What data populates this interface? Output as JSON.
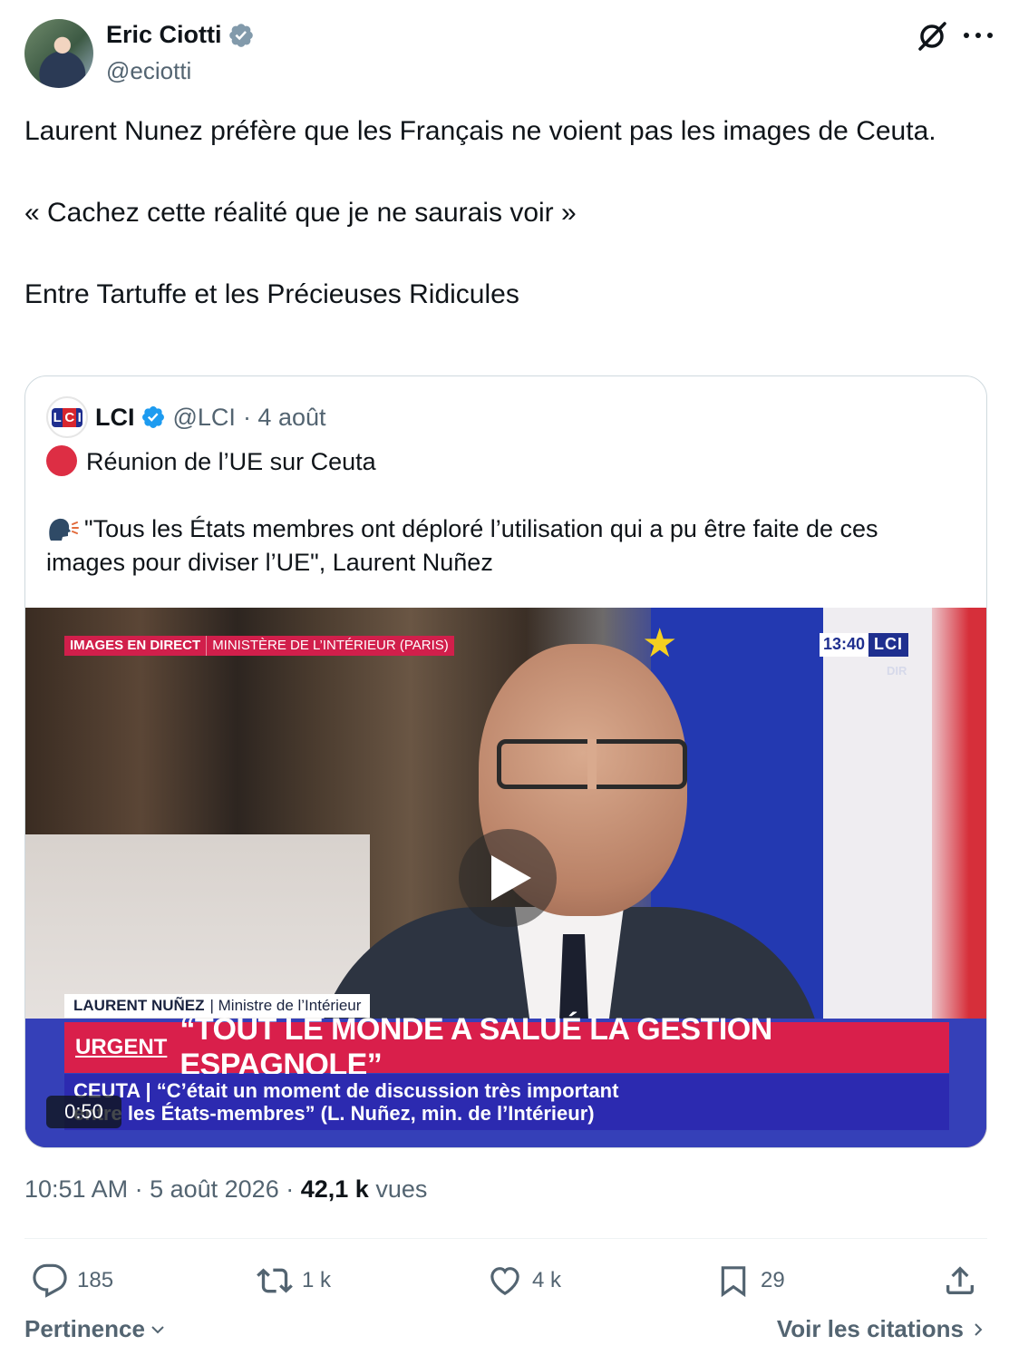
{
  "author": {
    "display_name": "Eric Ciotti",
    "handle": "@eciotti"
  },
  "tweet": {
    "lines": [
      "Laurent Nunez préfère que les Français ne voient pas les images de Ceuta.",
      "« Cachez cette réalité que je ne saurais voir »",
      "Entre Tartuffe et les Précieuses Ridicules"
    ]
  },
  "quote": {
    "avatar_letters": [
      "L",
      "C",
      "I"
    ],
    "name": "LCI",
    "handle": "@LCI",
    "date": "· 4 août",
    "line1": "Réunion de l’UE sur Ceuta",
    "line2": "\"Tous les États membres ont déploré l’utilisation qui a pu être faite de ces images pour diviser l’UE\", Laurent Nuñez",
    "video": {
      "banner_left": "IMAGES EN DIRECT",
      "banner_right": "MINISTÈRE DE L’INTÉRIEUR (PARIS)",
      "clock": "13:40",
      "channel_logo": "LCI",
      "channel_sub": "DIR",
      "person_name": "LAURENT NUÑEZ",
      "person_title": "| Ministre de l’Intérieur",
      "urgent_label": "URGENT",
      "urgent_text": "“TOUT LE MONDE A SALUÉ LA GESTION ESPAGNOLE”",
      "sub_line1": "CEUTA | “C’était un moment de discussion très important",
      "sub_line2": "entre les États-membres” (L. Nuñez, min. de l’Intérieur)",
      "duration": "0:50"
    }
  },
  "meta": {
    "time_date": "10:51 AM · 5 août 2026 ·",
    "views_count": "42,1 k",
    "views_label": "vues"
  },
  "actions": {
    "replies": "185",
    "reposts": "1 k",
    "likes": "4 k",
    "bookmarks": "29"
  },
  "footer": {
    "sort_label": "Pertinence",
    "citations_label": "Voir les citations"
  },
  "colors": {
    "verified": "#1d9bf0",
    "verified_gray": "#829aab",
    "urgent_red": "#d91f4b",
    "lci_blue": "#1f2f8f"
  },
  "icons": [
    "verified-badge-icon",
    "grok-icon",
    "more-icon",
    "red-circle-icon",
    "speaking-head-icon",
    "play-icon",
    "reply-icon",
    "repost-icon",
    "like-icon",
    "bookmark-icon",
    "share-icon",
    "chevron-down-icon",
    "chevron-right-icon"
  ]
}
